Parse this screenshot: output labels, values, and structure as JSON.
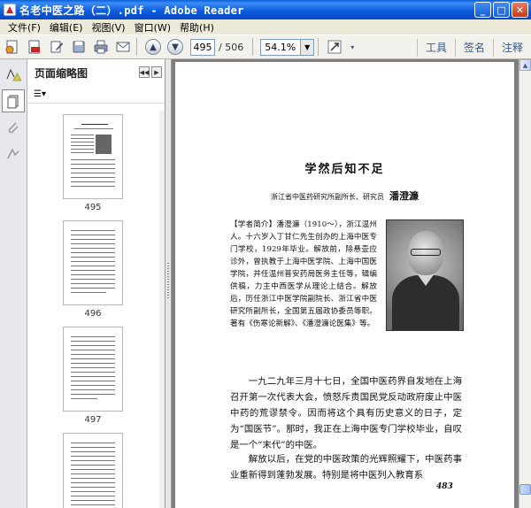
{
  "window": {
    "title": "名老中医之路（二）.pdf - Adobe Reader",
    "minimize_glyph": "_",
    "maximize_glyph": "□",
    "close_glyph": "✕"
  },
  "menu": [
    "文件(F)",
    "编辑(E)",
    "视图(V)",
    "窗口(W)",
    "帮助(H)"
  ],
  "toolbar": {
    "current_page": "495",
    "page_total": "/ 506",
    "zoom": "54.1%",
    "tools_label": "工具",
    "sign_label": "签名",
    "comment_label": "注释"
  },
  "thumbnails": {
    "header": "页面缩略图",
    "items": [
      {
        "label": "495"
      },
      {
        "label": "496"
      },
      {
        "label": "497"
      }
    ]
  },
  "document": {
    "title": "学然后知不足",
    "byline_org": "浙江省中医药研究所副所长、研究员",
    "byline_name": "潘澄濂",
    "bio": "【学者简介】潘澄濂（1910～），浙江温州人。十六岁入丁甘仁先生创办的上海中医专门学校，1929年毕业。解放前，除悬壶应诊外，曾执教于上海中医学院、上海中国医学院，并任温州普安药局医务主任等，辑编供稿，力主中西医学从理论上结合。解放后，历任浙江中医学院副院长、浙江省中医研究所副所长，全国第五届政协委员等职。著有《伤寒论新解》、《潘澄濂论医集》等。",
    "para1": "一九二九年三月十七日，全国中医药界自发地在上海召开第一次代表大会，愤怒斥责国民党反动政府废止中医中药的荒谬禁令。因而将这个具有历史意义的日子，定为“国医节”。那时，我正在上海中医专门学校毕业，自叹是一个“末代”的中医。",
    "para2": "解放以后，在党的中医政策的光辉照耀下，中医药事业重新得到蓬勃发展。特别是将中医列入教育系",
    "page_number": "483"
  }
}
